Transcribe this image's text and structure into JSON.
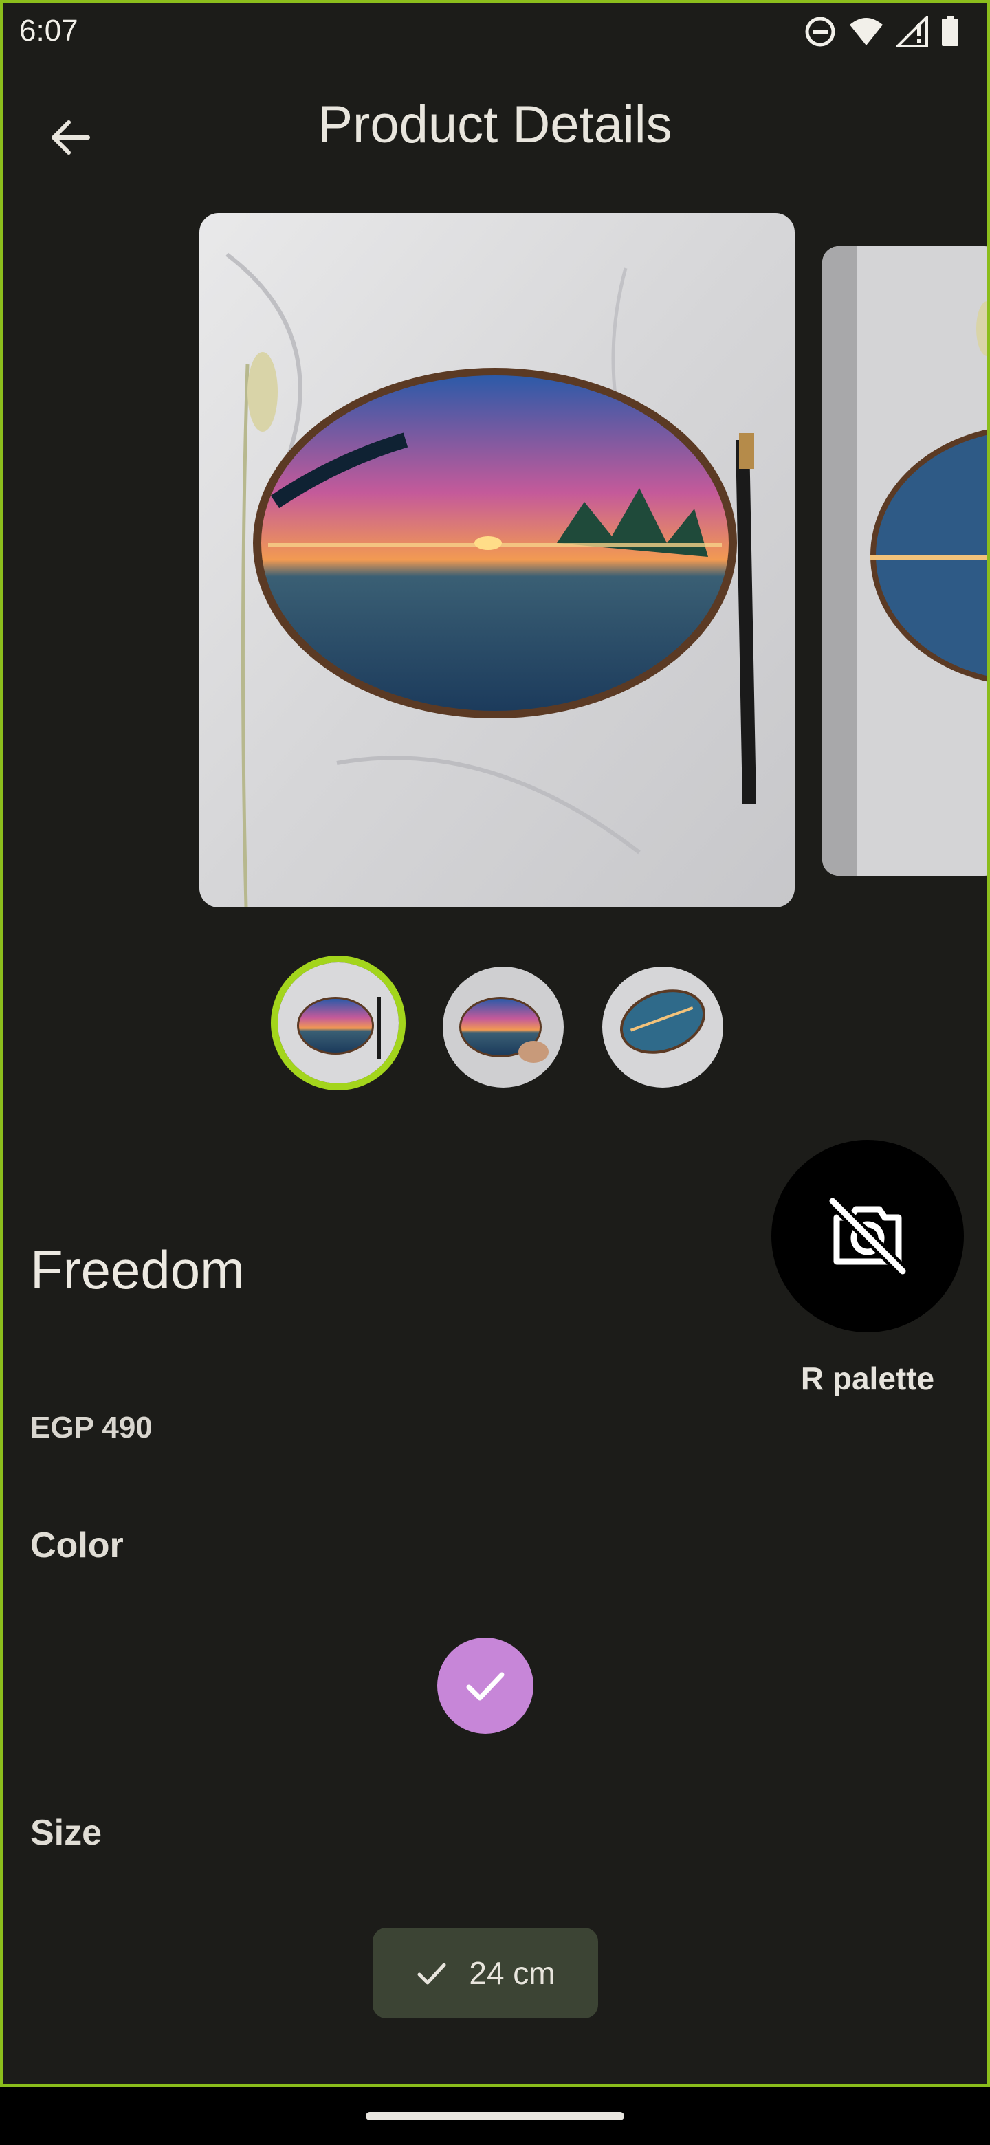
{
  "status_bar": {
    "time": "6:07",
    "icons": [
      "do-not-disturb-icon",
      "wifi-icon",
      "signal-icon",
      "battery-icon"
    ]
  },
  "app_bar": {
    "title": "Product Details",
    "back_icon": "arrow-left-icon"
  },
  "gallery": {
    "thumbnail_count": 3,
    "selected_index": 0
  },
  "seller": {
    "name": "R palette",
    "avatar_icon": "no-photo-icon"
  },
  "product": {
    "name": "Freedom",
    "price": "EGP 490"
  },
  "color_section": {
    "label": "Color",
    "selected_color": "#c786d8",
    "check_icon": "check-icon"
  },
  "size_section": {
    "label": "Size",
    "selected_size": "24 cm",
    "check_icon": "check-icon"
  },
  "colors": {
    "background": "#1c1c19",
    "accent": "#a3d51c",
    "chip": "#3c4434"
  }
}
